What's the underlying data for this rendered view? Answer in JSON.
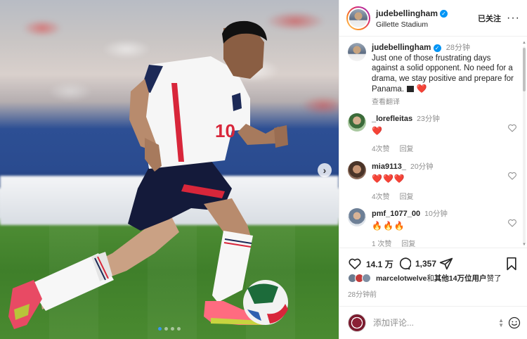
{
  "post": {
    "username": "judebellingham",
    "location": "Gillette Stadium",
    "follow_state": "已关注",
    "photo": {
      "banner_text": "",
      "jersey_number": "10",
      "carousel_dots": 4,
      "carousel_active": 0
    }
  },
  "caption": {
    "username": "judebellingham",
    "time": "28分钟",
    "text": "Just one of those frustrating days against a solid opponent. No need for a drama, we stay positive and prepare for Panama.",
    "see_translation": "查看翻译"
  },
  "comments": [
    {
      "username": "_lorefleitas",
      "time": "23分钟",
      "emojis": "❤️",
      "likes": "4次赞",
      "reply": "回复"
    },
    {
      "username": "mia9113_",
      "time": "20分钟",
      "emojis": "❤️❤️❤️",
      "likes": "4次赞",
      "reply": "回复"
    },
    {
      "username": "pmf_1077_00",
      "time": "10分钟",
      "emojis": "🔥🔥🔥",
      "likes": "1 次赞",
      "reply": "回复"
    }
  ],
  "actions": {
    "likes_count": "14.1 万",
    "comments_count": "1,357"
  },
  "likers": {
    "first": "marcelotwelve",
    "connector": "和",
    "others": "其他14万位用户",
    "suffix": "赞了"
  },
  "time_ago": "28分钟前",
  "add_comment": {
    "placeholder": "添加评论..."
  },
  "colors": {
    "verified": "#0095f6",
    "heart": "#ed4956",
    "meta_gray": "#8e8e8e",
    "england_red": "#d8263a"
  },
  "icons": [
    "verified-badge-icon",
    "more-options-icon",
    "heart-icon",
    "comment-icon",
    "share-icon",
    "bookmark-icon",
    "emoji-icon",
    "chevron-right-icon",
    "flag-icon"
  ]
}
